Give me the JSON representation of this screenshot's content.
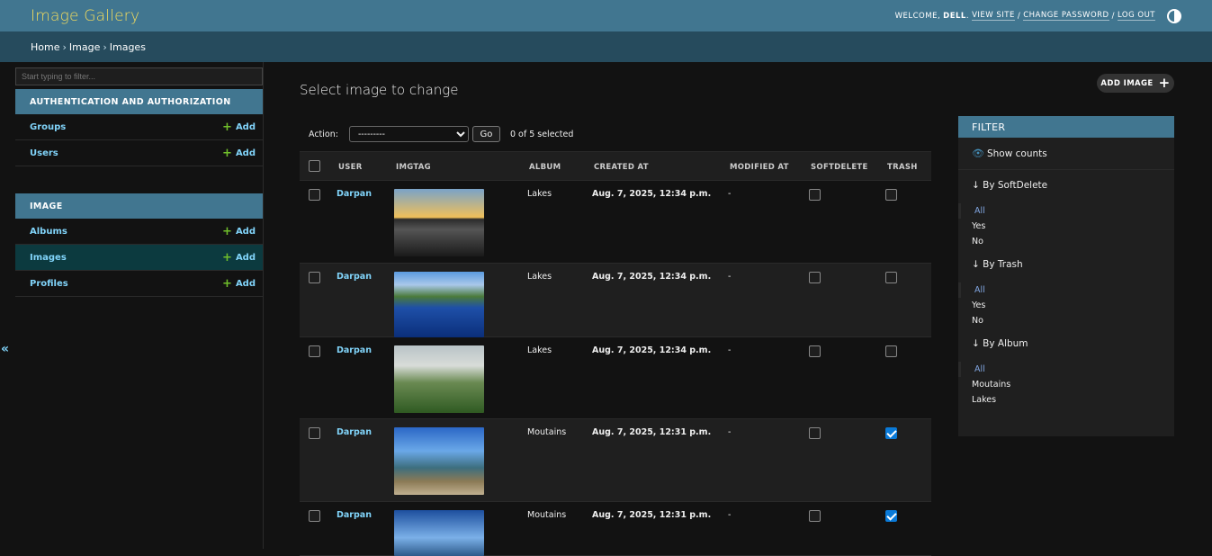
{
  "header": {
    "brand": "Image Gallery",
    "welcome": "WELCOME,",
    "username": "DELL",
    "links": [
      "VIEW SITE",
      "CHANGE PASSWORD",
      "LOG OUT"
    ],
    "separator": "/"
  },
  "breadcrumbs": [
    "Home",
    "Image",
    "Images"
  ],
  "breadcrumb_sep": "›",
  "sidebar": {
    "filter_placeholder": "Start typing to filter...",
    "apps": [
      {
        "name": "AUTHENTICATION AND AUTHORIZATION",
        "models": [
          {
            "name": "Groups",
            "add": "Add"
          },
          {
            "name": "Users",
            "add": "Add"
          }
        ]
      },
      {
        "name": "IMAGE",
        "models": [
          {
            "name": "Albums",
            "add": "Add"
          },
          {
            "name": "Images",
            "add": "Add"
          },
          {
            "name": "Profiles",
            "add": "Add"
          }
        ]
      }
    ],
    "collapse_glyph": "«"
  },
  "main": {
    "title": "Select image to change",
    "add_button": "ADD IMAGE",
    "action_label": "Action:",
    "action_value": "---------",
    "go_label": "Go",
    "selected_text": "0 of 5 selected"
  },
  "table": {
    "columns": [
      "USER",
      "IMGTAG",
      "ALBUM",
      "CREATED AT",
      "MODIFIED AT",
      "SOFTDELETE",
      "TRASH"
    ],
    "rows": [
      {
        "user": "Darpan",
        "album": "Lakes",
        "created": "Aug. 7, 2025, 12:34 p.m.",
        "modified": "-",
        "softdelete": false,
        "trash": false
      },
      {
        "user": "Darpan",
        "album": "Lakes",
        "created": "Aug. 7, 2025, 12:34 p.m.",
        "modified": "-",
        "softdelete": false,
        "trash": false
      },
      {
        "user": "Darpan",
        "album": "Lakes",
        "created": "Aug. 7, 2025, 12:34 p.m.",
        "modified": "-",
        "softdelete": false,
        "trash": false
      },
      {
        "user": "Darpan",
        "album": "Moutains",
        "created": "Aug. 7, 2025, 12:31 p.m.",
        "modified": "-",
        "softdelete": false,
        "trash": true
      },
      {
        "user": "Darpan",
        "album": "Moutains",
        "created": "Aug. 7, 2025, 12:31 p.m.",
        "modified": "-",
        "softdelete": false,
        "trash": true
      }
    ]
  },
  "filter": {
    "title": "FILTER",
    "show_counts": "Show counts",
    "sections": [
      {
        "title": "↓ By SoftDelete",
        "options": [
          "All",
          "Yes",
          "No"
        ]
      },
      {
        "title": "↓ By Trash",
        "options": [
          "All",
          "Yes",
          "No"
        ]
      },
      {
        "title": "↓ By Album",
        "options": [
          "All",
          "Moutains",
          "Lakes"
        ]
      }
    ]
  },
  "colors": {
    "header": "#417690",
    "breadcrumbs": "#264b5d",
    "brand": "#f5dd5d",
    "link": "#81d4fa",
    "add_plus": "#70bf2b",
    "checkbox_checked": "#0a7ad8"
  }
}
